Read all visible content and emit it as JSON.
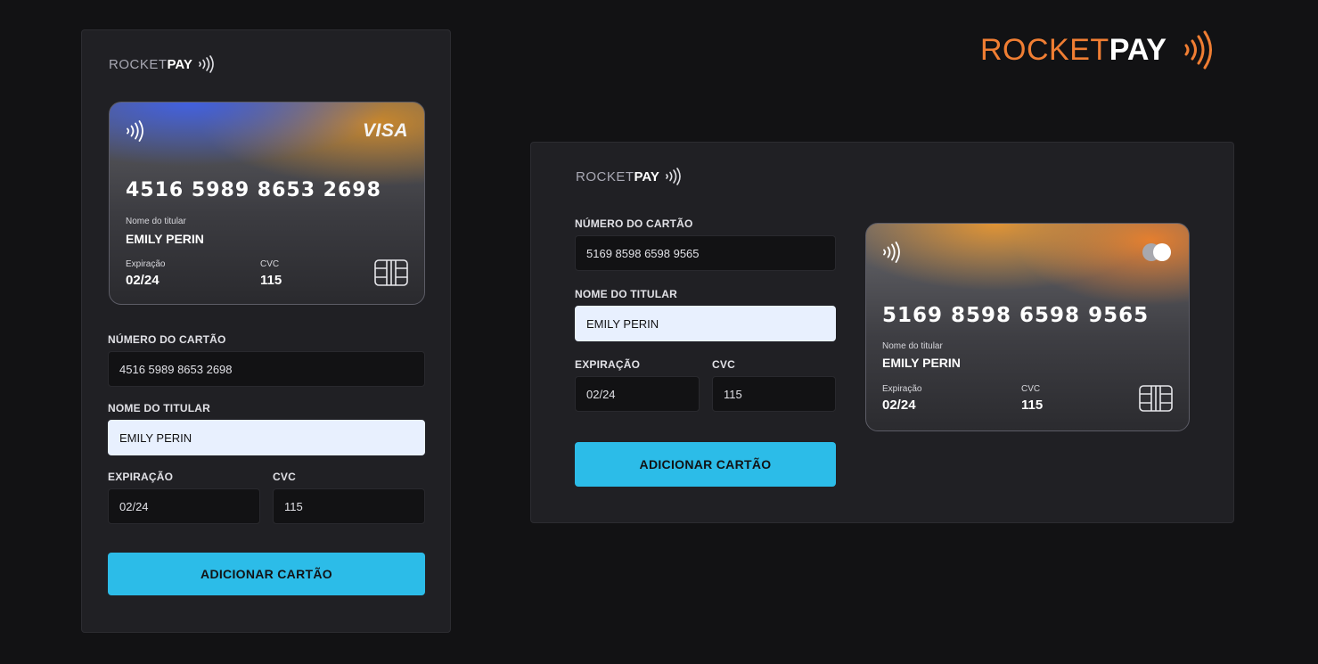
{
  "brand": {
    "light": "ROCKET",
    "bold": "PAY",
    "accent_color": "#f07e33"
  },
  "colors": {
    "background": "#121214",
    "panel": "#202024",
    "button": "#2cbce8",
    "autofill": "#e8f0fe"
  },
  "mobile": {
    "card": {
      "network": "VISA",
      "number": "4516 5989 8653 2698",
      "holder_label": "Nome do titular",
      "holder": "EMILY PERIN",
      "expiry_label": "Expiração",
      "expiry": "02/24",
      "cvc_label": "CVC",
      "cvc": "115"
    },
    "form": {
      "number_label": "NÚMERO DO CARTÃO",
      "number_value": "4516 5989 8653 2698",
      "holder_label": "NOME DO TITULAR",
      "holder_value": "EMILY PERIN",
      "expiry_label": "EXPIRAÇÃO",
      "expiry_value": "02/24",
      "cvc_label": "CVC",
      "cvc_value": "115",
      "submit_label": "ADICIONAR CARTÃO"
    }
  },
  "desktop": {
    "card": {
      "network_icon": "mastercard-icon",
      "number": "5169 8598 6598 9565",
      "holder_label": "Nome do titular",
      "holder": "EMILY PERIN",
      "expiry_label": "Expiração",
      "expiry": "02/24",
      "cvc_label": "CVC",
      "cvc": "115"
    },
    "form": {
      "number_label": "NÚMERO DO CARTÃO",
      "number_value": "5169 8598 6598 9565",
      "holder_label": "NOME DO TITULAR",
      "holder_value": "EMILY PERIN",
      "expiry_label": "EXPIRAÇÃO",
      "expiry_value": "02/24",
      "cvc_label": "CVC",
      "cvc_value": "115",
      "submit_label": "ADICIONAR CARTÃO"
    }
  }
}
